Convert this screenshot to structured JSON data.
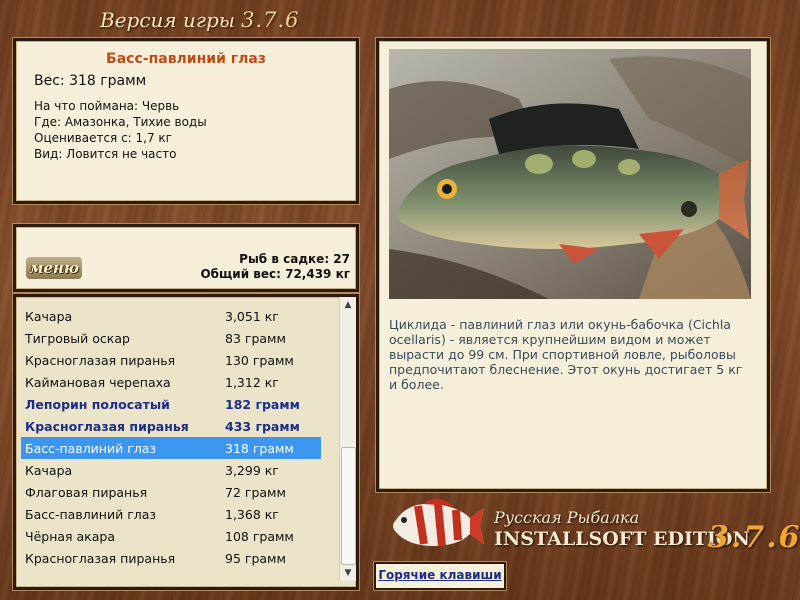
{
  "header": {
    "title": "Версия игры",
    "version": "3.7.6"
  },
  "fish_info": {
    "name": "Басс-павлиний глаз",
    "weight": "Вес: 318 грамм",
    "lines": [
      "На что поймана: Червь",
      "Где: Амазонка, Тихие воды",
      "Оценивается с: 1,7 кг",
      "Вид: Ловится не часто"
    ]
  },
  "stats": {
    "menu_label": "меню",
    "fish_count": "Рыб в садке: 27",
    "total_weight": "Общий вес: 72,439 кг"
  },
  "catch_list": [
    {
      "name": "Качара",
      "weight": "3,051 кг",
      "style": "normal"
    },
    {
      "name": "Тигровый оскар",
      "weight": "83 грамм",
      "style": "normal"
    },
    {
      "name": "Красноглазая пиранья",
      "weight": "130 грамм",
      "style": "normal"
    },
    {
      "name": "Каймановая черепаха",
      "weight": "1,312 кг",
      "style": "normal"
    },
    {
      "name": "Лепорин полосатый",
      "weight": "182 грамм",
      "style": "bold"
    },
    {
      "name": "Красноглазая пиранья",
      "weight": "433 грамм",
      "style": "bold"
    },
    {
      "name": "Басс-павлиний глаз",
      "weight": "318 грамм",
      "style": "selected"
    },
    {
      "name": "Качара",
      "weight": "3,299 кг",
      "style": "normal"
    },
    {
      "name": "Флаговая пиранья",
      "weight": "72 грамм",
      "style": "normal"
    },
    {
      "name": "Басс-павлиний глаз",
      "weight": "1,368 кг",
      "style": "normal"
    },
    {
      "name": "Чёрная акара",
      "weight": "108 грамм",
      "style": "normal"
    },
    {
      "name": "Красноглазая пиранья",
      "weight": "95 грамм",
      "style": "normal"
    }
  ],
  "description": "Циклида - павлиний глаз или окунь-бабочка (Cichla ocellaris) - является крупнейшим видом и может вырасти до 99 см. При спортивной ловле, рыболовы предпочитают блеснение. Этот окунь достигает 5 кг и более.",
  "branding": {
    "line1": "Русская Рыбалка",
    "line2": "INSTALLSOFT EDITION",
    "version": "3.7.6"
  },
  "hotkeys_label": "Горячие клавиши",
  "colors": {
    "selected_row": "#3a96f0",
    "bold_row": "#1a2e8a",
    "fish_name": "#c24a14",
    "version_orange": "#f0a630"
  }
}
